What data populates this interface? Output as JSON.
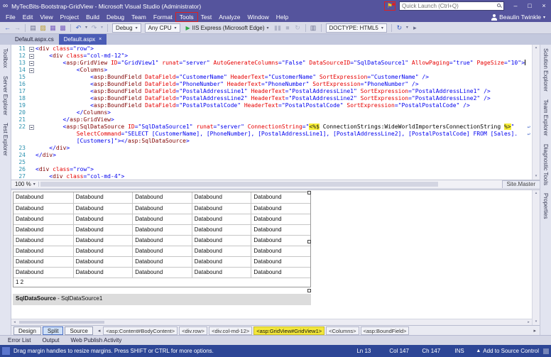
{
  "colors": {
    "frame_purple": "#55549d",
    "toolbar_bg": "#dadce9",
    "tab_bar_bg": "#c3c8dd",
    "active_tab_blue": "#4a5cb5",
    "side_strip_bg": "#e2e4f0",
    "status_bar_blue": "#2d4696",
    "annotation_red": "#e02020",
    "server_tag_highlight": "#f8ee34",
    "code_tag": "#800000",
    "code_attribute": "#e60000",
    "code_value": "#0000ee",
    "line_number_teal": "#2b91af",
    "run_green": "#2faa44",
    "flag_yellow": "#f5c823"
  },
  "glyphs": {
    "logo": "∞",
    "flag": "⚑",
    "minimize": "–",
    "maximize": "□",
    "close": "×",
    "tab_close": "×",
    "caret_down": "▾",
    "caret_up": "▴",
    "up_arrow": "▲",
    "arrow_left": "◂",
    "arrow_right": "▸",
    "play": "▶",
    "wrap_return": "↩"
  },
  "title_bar": {
    "app_title": "MyTecBits-Bootstrap-GridView - Microsoft Visual Studio  (Administrator)",
    "quick_launch_placeholder": "Quick Launch (Ctrl+Q)"
  },
  "menu_bar": {
    "items": [
      "File",
      "Edit",
      "View",
      "Project",
      "Build",
      "Debug",
      "Team",
      "Format",
      "Tools",
      "Test",
      "Analyze",
      "Window",
      "Help"
    ],
    "annotated_item": "Tools",
    "user_name": "Beaulin Twinkle"
  },
  "toolbar": {
    "items": [
      {
        "t": "icon",
        "name": "nav-backward-icon",
        "g": "←",
        "c": "#3f63c8"
      },
      {
        "t": "icon",
        "name": "nav-forward-icon",
        "g": "→",
        "c": "#9ba1bd"
      },
      {
        "t": "sep"
      },
      {
        "t": "icon",
        "name": "new-project-icon",
        "g": "▤",
        "c": "#6b7090"
      },
      {
        "t": "icon",
        "name": "open-file-icon",
        "g": "▨",
        "c": "#b99a2e"
      },
      {
        "t": "icon",
        "name": "save-icon",
        "g": "▦",
        "c": "#7a5fbe"
      },
      {
        "t": "icon",
        "name": "save-all-icon",
        "g": "▩",
        "c": "#7a5fbe"
      },
      {
        "t": "sep"
      },
      {
        "t": "icon",
        "name": "undo-icon",
        "g": "↶",
        "c": "#3f63c8"
      },
      {
        "t": "icon",
        "name": "undo-dropdown-caret-icon",
        "g": "▾",
        "c": "#666b8a",
        "small": true
      },
      {
        "t": "icon",
        "name": "redo-icon",
        "g": "↷",
        "c": "#9ba1bd"
      },
      {
        "t": "icon",
        "name": "redo-dropdown-caret-icon",
        "g": "▾",
        "c": "#9ba1bd",
        "small": true
      },
      {
        "t": "sep"
      },
      {
        "t": "dropdown",
        "name": "solution-configuration-dropdown",
        "label": "Debug"
      },
      {
        "t": "dropdown",
        "name": "solution-platform-dropdown",
        "label": "Any CPU"
      },
      {
        "t": "run",
        "name": "start-debugging-button",
        "label": "IIS Express (Microsoft Edge)"
      },
      {
        "t": "icon",
        "name": "pause-icon",
        "g": "▮▮",
        "c": "#b0b4c8"
      },
      {
        "t": "icon",
        "name": "stop-icon",
        "g": "■",
        "c": "#b0b4c8"
      },
      {
        "t": "icon",
        "name": "restart-icon",
        "g": "↻",
        "c": "#b0b4c8"
      },
      {
        "t": "sep"
      },
      {
        "t": "icon",
        "name": "show-output-icon",
        "g": "▥",
        "c": "#6b7090"
      },
      {
        "t": "sep"
      },
      {
        "t": "dropdown",
        "name": "doctype-dropdown",
        "label": "DOCTYPE: HTML5"
      },
      {
        "t": "sep"
      },
      {
        "t": "icon",
        "name": "browser-link-refresh-icon",
        "g": "↻",
        "c": "#3f63c8"
      },
      {
        "t": "icon",
        "name": "browser-link-caret-icon",
        "g": "▾",
        "c": "#666b8a",
        "small": true
      },
      {
        "t": "icon",
        "name": "toolbar-overflow-icon",
        "g": "▸",
        "c": "#666b8a"
      }
    ]
  },
  "document_tabs": [
    {
      "label": "Default.aspx.cs",
      "active": false
    },
    {
      "label": "Default.aspx",
      "active": true
    }
  ],
  "left_panel_tabs": [
    "Toolbox",
    "Server Explorer",
    "Test Explorer"
  ],
  "right_panel_tabs": [
    "Solution Explorer",
    "Team Explorer",
    "Diagnostic Tools",
    "Properties"
  ],
  "editor": {
    "zoom_level": "100 %",
    "lines": [
      {
        "num": "11",
        "fold": true,
        "tokens": [
          [
            "d",
            "<"
          ],
          [
            "t",
            "div"
          ],
          [
            "p",
            " "
          ],
          [
            "a",
            "class"
          ],
          [
            "v",
            "=\"row\""
          ],
          [
            "d",
            ">"
          ]
        ]
      },
      {
        "num": "12",
        "fold": true,
        "tokens": [
          [
            "p",
            "    "
          ],
          [
            "d",
            "<"
          ],
          [
            "t",
            "div"
          ],
          [
            "p",
            " "
          ],
          [
            "a",
            "class"
          ],
          [
            "v",
            "=\"col-md-12\""
          ],
          [
            "d",
            ">"
          ]
        ]
      },
      {
        "num": "13",
        "fold": true,
        "caret": true,
        "tokens": [
          [
            "p",
            "        "
          ],
          [
            "d",
            "<"
          ],
          [
            "t",
            "asp:GridView"
          ],
          [
            "p",
            " "
          ],
          [
            "a",
            "ID"
          ],
          [
            "v",
            "=\"GridView1\""
          ],
          [
            "p",
            " "
          ],
          [
            "a",
            "runat"
          ],
          [
            "v",
            "=\"server\""
          ],
          [
            "p",
            " "
          ],
          [
            "a",
            "AutoGenerateColumns"
          ],
          [
            "v",
            "=\"False\""
          ],
          [
            "p",
            " "
          ],
          [
            "a",
            "DataSourceID"
          ],
          [
            "v",
            "=\"SqlDataSource1\""
          ],
          [
            "p",
            " "
          ],
          [
            "a",
            "AllowPaging"
          ],
          [
            "v",
            "=\"true\""
          ],
          [
            "p",
            " "
          ],
          [
            "a",
            "PageSize"
          ],
          [
            "v",
            "=\"10\""
          ],
          [
            "d",
            ">"
          ]
        ]
      },
      {
        "num": "14",
        "fold": true,
        "tokens": [
          [
            "p",
            "            "
          ],
          [
            "d",
            "<"
          ],
          [
            "t",
            "Columns"
          ],
          [
            "d",
            ">"
          ]
        ]
      },
      {
        "num": "15",
        "tokens": [
          [
            "p",
            "                "
          ],
          [
            "d",
            "<"
          ],
          [
            "t",
            "asp:BoundField"
          ],
          [
            "p",
            " "
          ],
          [
            "a",
            "DataField"
          ],
          [
            "v",
            "=\"CustomerName\""
          ],
          [
            "p",
            " "
          ],
          [
            "a",
            "HeaderText"
          ],
          [
            "v",
            "=\"CustomerName\""
          ],
          [
            "p",
            " "
          ],
          [
            "a",
            "SortExpression"
          ],
          [
            "v",
            "=\"CustomerName\""
          ],
          [
            "p",
            " "
          ],
          [
            "d",
            "/>"
          ]
        ]
      },
      {
        "num": "16",
        "tokens": [
          [
            "p",
            "                "
          ],
          [
            "d",
            "<"
          ],
          [
            "t",
            "asp:BoundField"
          ],
          [
            "p",
            " "
          ],
          [
            "a",
            "DataField"
          ],
          [
            "v",
            "=\"PhoneNumber\""
          ],
          [
            "p",
            " "
          ],
          [
            "a",
            "HeaderText"
          ],
          [
            "v",
            "=\"PhoneNumber\""
          ],
          [
            "p",
            " "
          ],
          [
            "a",
            "SortExpression"
          ],
          [
            "v",
            "=\"PhoneNumber\""
          ],
          [
            "p",
            " "
          ],
          [
            "d",
            "/>"
          ]
        ]
      },
      {
        "num": "17",
        "tokens": [
          [
            "p",
            "                "
          ],
          [
            "d",
            "<"
          ],
          [
            "t",
            "asp:BoundField"
          ],
          [
            "p",
            " "
          ],
          [
            "a",
            "DataField"
          ],
          [
            "v",
            "=\"PostalAddressLine1\""
          ],
          [
            "p",
            " "
          ],
          [
            "a",
            "HeaderText"
          ],
          [
            "v",
            "=\"PostalAddressLine1\""
          ],
          [
            "p",
            " "
          ],
          [
            "a",
            "SortExpression"
          ],
          [
            "v",
            "=\"PostalAddressLine1\""
          ],
          [
            "p",
            " "
          ],
          [
            "d",
            "/>"
          ]
        ]
      },
      {
        "num": "18",
        "tokens": [
          [
            "p",
            "                "
          ],
          [
            "d",
            "<"
          ],
          [
            "t",
            "asp:BoundField"
          ],
          [
            "p",
            " "
          ],
          [
            "a",
            "DataField"
          ],
          [
            "v",
            "=\"PostalAddressLine2\""
          ],
          [
            "p",
            " "
          ],
          [
            "a",
            "HeaderText"
          ],
          [
            "v",
            "=\"PostalAddressLine2\""
          ],
          [
            "p",
            " "
          ],
          [
            "a",
            "SortExpression"
          ],
          [
            "v",
            "=\"PostalAddressLine2\""
          ],
          [
            "p",
            " "
          ],
          [
            "d",
            "/>"
          ]
        ]
      },
      {
        "num": "19",
        "tokens": [
          [
            "p",
            "                "
          ],
          [
            "d",
            "<"
          ],
          [
            "t",
            "asp:BoundField"
          ],
          [
            "p",
            " "
          ],
          [
            "a",
            "DataField"
          ],
          [
            "v",
            "=\"PostalPostalCode\""
          ],
          [
            "p",
            " "
          ],
          [
            "a",
            "HeaderText"
          ],
          [
            "v",
            "=\"PostalPostalCode\""
          ],
          [
            "p",
            " "
          ],
          [
            "a",
            "SortExpression"
          ],
          [
            "v",
            "=\"PostalPostalCode\""
          ],
          [
            "p",
            " "
          ],
          [
            "d",
            "/>"
          ]
        ]
      },
      {
        "num": "20",
        "tokens": [
          [
            "p",
            "            "
          ],
          [
            "d",
            "</"
          ],
          [
            "t",
            "Columns"
          ],
          [
            "d",
            ">"
          ]
        ]
      },
      {
        "num": "21",
        "tokens": [
          [
            "p",
            "        "
          ],
          [
            "d",
            "</"
          ],
          [
            "t",
            "asp:GridView"
          ],
          [
            "d",
            ">"
          ]
        ]
      },
      {
        "num": "22",
        "fold": true,
        "wrap_arrow": true,
        "tokens": [
          [
            "p",
            "        "
          ],
          [
            "d",
            "<"
          ],
          [
            "t",
            "asp:SqlDataSource"
          ],
          [
            "p",
            " "
          ],
          [
            "a",
            "ID"
          ],
          [
            "v",
            "=\"SqlDataSource1\""
          ],
          [
            "p",
            " "
          ],
          [
            "a",
            "runat"
          ],
          [
            "v",
            "=\"server\""
          ],
          [
            "p",
            " "
          ],
          [
            "a",
            "ConnectionString"
          ],
          [
            "v",
            "=\""
          ],
          [
            "h",
            "<%$"
          ],
          [
            "p",
            " ConnectionStrings:WideWorldImportersConnectionString "
          ],
          [
            "h",
            "%>"
          ],
          [
            "v",
            "\""
          ]
        ]
      },
      {
        "num": "",
        "wrap_arrow": true,
        "tokens": [
          [
            "p",
            "            "
          ],
          [
            "a",
            "SelectCommand"
          ],
          [
            "v",
            "=\"SELECT [CustomerName], [PhoneNumber], [PostalAddressLine1], [PostalAddressLine2], [PostalPostalCode] FROM [Sales]."
          ]
        ]
      },
      {
        "num": "",
        "tokens": [
          [
            "p",
            "            "
          ],
          [
            "v",
            "[Customers]\""
          ],
          [
            "d",
            "></"
          ],
          [
            "t",
            "asp:SqlDataSource"
          ],
          [
            "d",
            ">"
          ]
        ]
      },
      {
        "num": "23",
        "tokens": [
          [
            "p",
            "    "
          ],
          [
            "d",
            "</"
          ],
          [
            "t",
            "div"
          ],
          [
            "d",
            ">"
          ]
        ]
      },
      {
        "num": "24",
        "tokens": [
          [
            "d",
            "</"
          ],
          [
            "t",
            "div"
          ],
          [
            "d",
            ">"
          ]
        ]
      },
      {
        "num": "25",
        "tokens": []
      },
      {
        "num": "26",
        "tokens": [
          [
            "d",
            "<"
          ],
          [
            "t",
            "div"
          ],
          [
            "p",
            " "
          ],
          [
            "a",
            "class"
          ],
          [
            "v",
            "=\"row\""
          ],
          [
            "d",
            ">"
          ]
        ]
      },
      {
        "num": "27",
        "tokens": [
          [
            "p",
            "    "
          ],
          [
            "d",
            "<"
          ],
          [
            "t",
            "div"
          ],
          [
            "p",
            " "
          ],
          [
            "a",
            "class"
          ],
          [
            "v",
            "=\"col-md-4\""
          ],
          [
            "d",
            ">"
          ]
        ]
      }
    ]
  },
  "design_view": {
    "master_page_label": "Site.Master",
    "grid": {
      "rows": 8,
      "columns": 5,
      "cell_text": "Databound",
      "pager_text": "1 2"
    },
    "datasource_type": "SqlDataSource",
    "datasource_suffix": " - SqlDataSource1"
  },
  "view_switcher": {
    "buttons": [
      "Design",
      "Split",
      "Source"
    ],
    "active": "Split"
  },
  "tag_path": {
    "items": [
      "<asp:Content#BodyContent>",
      "<div.row>",
      "<div.col-md-12>",
      "<asp:GridView#GridView1>",
      "<Columns>",
      "<asp:BoundField>"
    ],
    "active": "<asp:GridView#GridView1>"
  },
  "bottom_panel_tabs": [
    "Error List",
    "Output",
    "Web Publish Activity"
  ],
  "status_bar": {
    "message": "Drag margin handles to resize margins. Press SHIFT or CTRL for more options.",
    "line": "Ln 13",
    "column": "Col 147",
    "character": "Ch 147",
    "mode": "INS",
    "source_control": "Add to Source Control"
  }
}
